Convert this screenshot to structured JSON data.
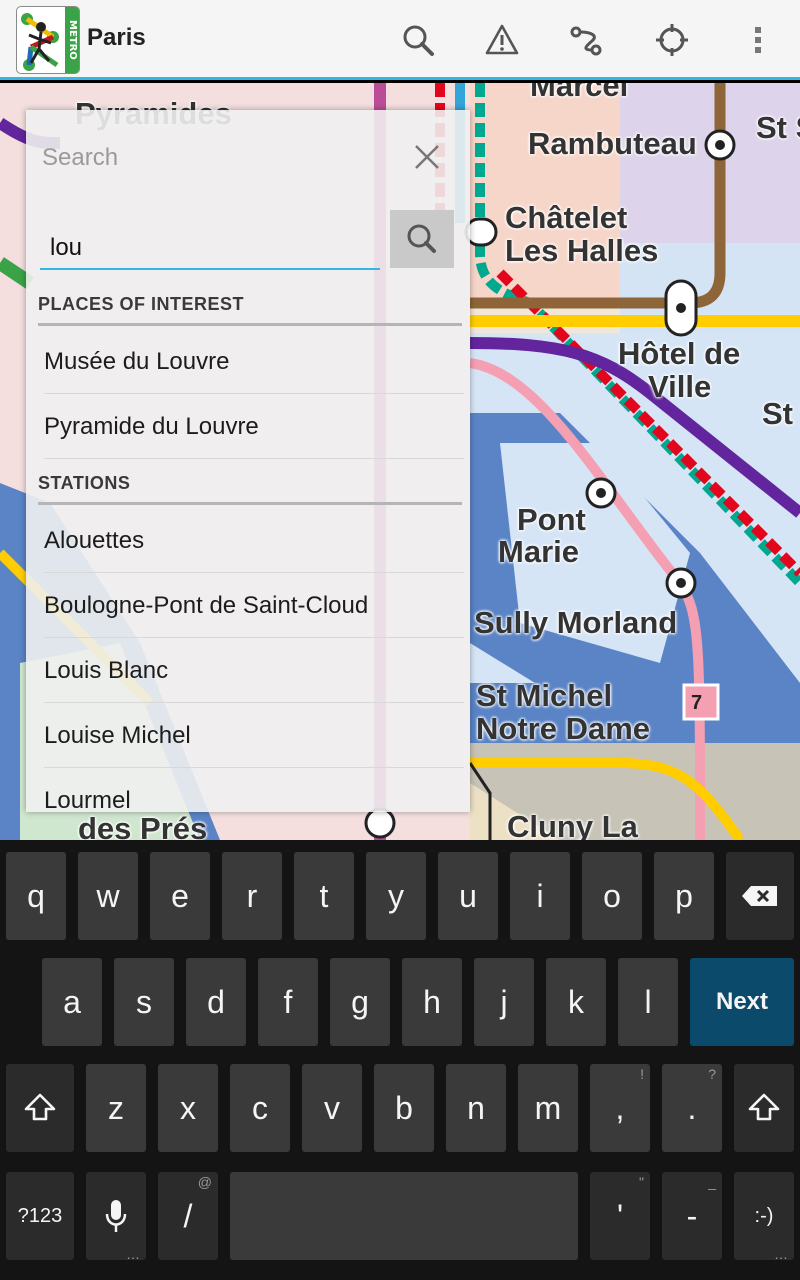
{
  "actionbar": {
    "logo_strip_text": "METRO",
    "title": "Paris",
    "icons": [
      "search-icon",
      "warning-icon",
      "route-icon",
      "locate-icon",
      "overflow-menu-icon"
    ]
  },
  "map": {
    "labels": [
      {
        "text": "Pyramides",
        "id": "pyramides"
      },
      {
        "text": "Marcel",
        "id": "marcel"
      },
      {
        "text": "Rambuteau",
        "id": "rambuteau"
      },
      {
        "text": "St S",
        "id": "st-s"
      },
      {
        "text": "Châtelet",
        "id": "chatelet-1"
      },
      {
        "text": "Les Halles",
        "id": "chatelet-2"
      },
      {
        "text": "Hôtel de",
        "id": "hotel-1"
      },
      {
        "text": "Ville",
        "id": "hotel-2"
      },
      {
        "text": "St",
        "id": "st-right"
      },
      {
        "text": "Pont",
        "id": "pont-1"
      },
      {
        "text": "Marie",
        "id": "pont-2"
      },
      {
        "text": "Sully Morland",
        "id": "sully"
      },
      {
        "text": "St Michel",
        "id": "stmichel-1"
      },
      {
        "text": "Notre Dame",
        "id": "stmichel-2"
      },
      {
        "text": "Cluny La",
        "id": "cluny"
      },
      {
        "text": "des Prés",
        "id": "despres"
      }
    ],
    "line_badge": "7"
  },
  "popup": {
    "search_hint": "Search",
    "query": "lou",
    "sections": [
      {
        "title": "PLACES OF INTEREST",
        "items": [
          "Musée du Louvre",
          "Pyramide du Louvre"
        ]
      },
      {
        "title": "STATIONS",
        "items": [
          "Alouettes",
          "Boulogne-Pont de Saint-Cloud",
          "Louis Blanc",
          "Louise Michel",
          "Lourmel"
        ]
      }
    ]
  },
  "keyboard": {
    "row1": [
      "q",
      "w",
      "e",
      "r",
      "t",
      "y",
      "u",
      "i",
      "o",
      "p"
    ],
    "row2": [
      "a",
      "s",
      "d",
      "f",
      "g",
      "h",
      "j",
      "k",
      "l"
    ],
    "row3": [
      "z",
      "x",
      "c",
      "v",
      "b",
      "n",
      "m",
      ",",
      "."
    ],
    "row3_subs": {
      ",": "!",
      ".": "?"
    },
    "next_label": "Next",
    "symbols_label": "?123",
    "slash_label": "/",
    "slash_sub": "@",
    "apostrophe_label": "'",
    "apostrophe_sub": "\"",
    "dash_label": "-",
    "dash_sub": "_",
    "smiley_label": ":-)"
  },
  "colors": {
    "accent": "#33b5e5",
    "next_key": "#0b4a6b",
    "line_1": "#ffcd00",
    "line_4": "#bb4d98",
    "line_7": "#f59fb3",
    "line_11": "#8d6538",
    "line_14": "#62259d",
    "rer_a": "#e3051c",
    "rer_b": "#00a88f"
  }
}
